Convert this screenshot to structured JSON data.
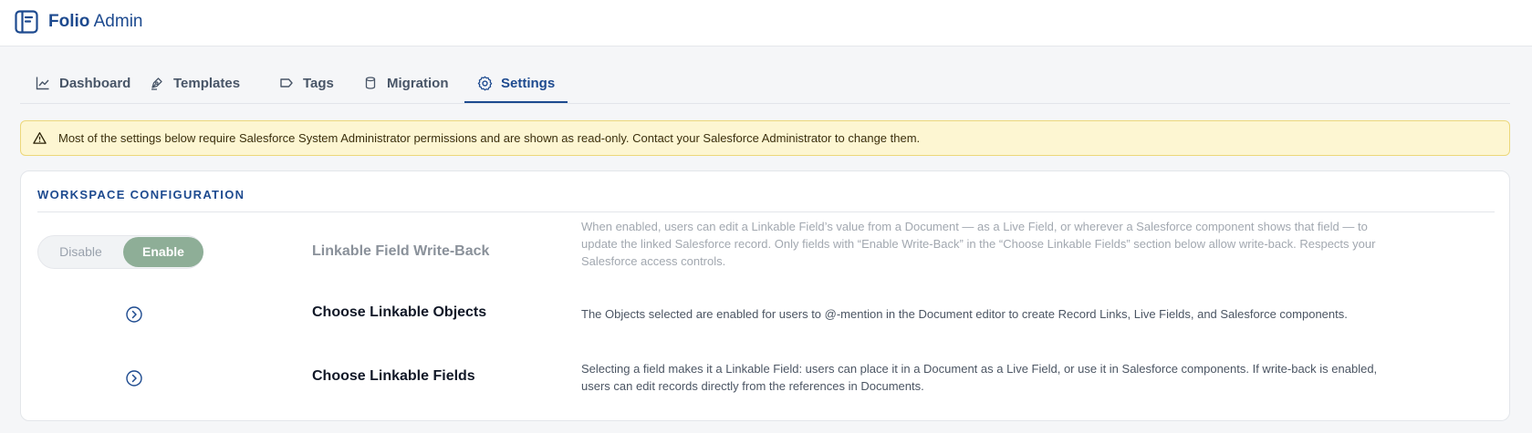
{
  "app": {
    "brand_bold": "Folio",
    "brand_rest": " Admin"
  },
  "tabs": [
    {
      "label": "Dashboard",
      "icon": "chart-line-icon",
      "active": false
    },
    {
      "label": "Templates",
      "icon": "pen-tool-icon",
      "active": false
    },
    {
      "label": "Tags",
      "icon": "tag-icon",
      "active": false
    },
    {
      "label": "Migration",
      "icon": "database-icon",
      "active": false
    },
    {
      "label": "Settings",
      "icon": "gear-icon",
      "active": true
    }
  ],
  "banner": {
    "icon": "warning-triangle-icon",
    "text": "Most of the settings below require Salesforce System Administrator permissions and are shown as read-only. Contact your Salesforce Administrator to change them."
  },
  "workspace": {
    "title": "WORKSPACE CONFIGURATION",
    "toggle": {
      "disable_label": "Disable",
      "enable_label": "Enable",
      "selected": "Enable"
    },
    "rows": [
      {
        "label": "Linkable Field Write-Back",
        "description": "When enabled, users can edit a Linkable Field’s value from a Document — as a Live Field, or wherever a Salesforce component shows that field — to update the linked Salesforce record. Only fields with “Enable Write-Back” in the “Choose Linkable Fields” section below allow write-back. Respects your Salesforce access controls."
      },
      {
        "label": "Choose Linkable Objects",
        "description": "The Objects selected are enabled for users to @-mention in the Document editor to create Record Links, Live Fields, and Salesforce components."
      },
      {
        "label": "Choose Linkable Fields",
        "description": "Selecting a field makes it a Linkable Field: users can place it in a Document as a Live Field, or use it in Salesforce components. If write-back is enabled, users can edit records directly from the references in Documents."
      }
    ]
  },
  "colors": {
    "accent": "#1d4a8f",
    "toggle_on": "#8eae97",
    "banner_bg": "#fdf6d2"
  }
}
